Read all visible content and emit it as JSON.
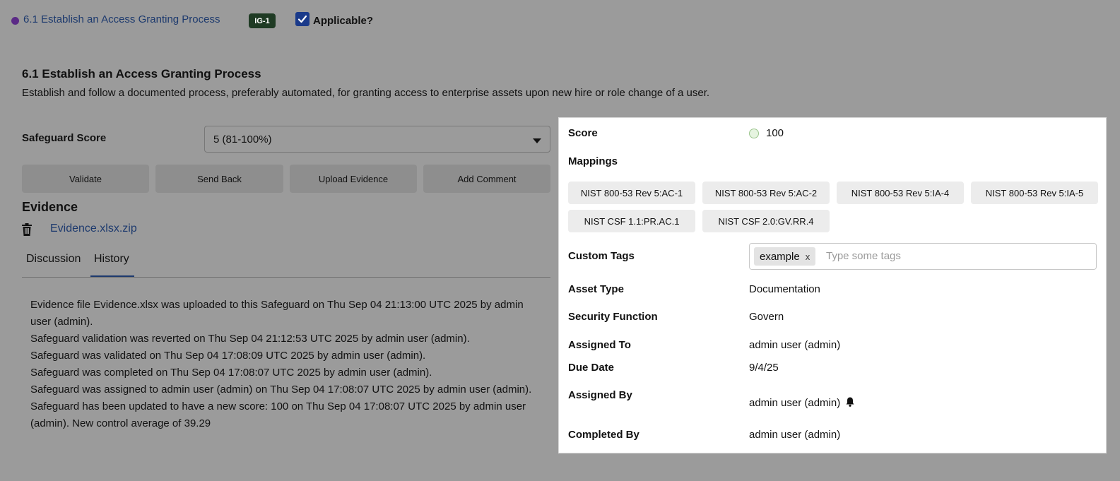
{
  "header": {
    "safeguard_link": "6.1 Establish an Access Granting Process",
    "ig_badge": "IG-1",
    "applicable_label": "Applicable?",
    "applicable_checked": true
  },
  "safeguard": {
    "title": "6.1 Establish an Access Granting Process",
    "description": "Establish and follow a documented process, preferably automated, for granting access to enterprise assets upon new hire or role change of a user."
  },
  "score_field": {
    "label": "Safeguard Score",
    "selected": "5 (81-100%)"
  },
  "actions": {
    "validate": "Validate",
    "send_back": "Send Back",
    "upload_evidence": "Upload Evidence",
    "add_comment": "Add Comment"
  },
  "evidence": {
    "title": "Evidence",
    "file": "Evidence.xlsx.zip"
  },
  "tabs": [
    {
      "label": "Discussion",
      "active": false
    },
    {
      "label": "History",
      "active": true
    }
  ],
  "history": [
    "Evidence file Evidence.xlsx was uploaded to this Safeguard on Thu Sep 04 21:13:00 UTC 2025 by admin user (admin).",
    "Safeguard validation was reverted on Thu Sep 04 21:12:53 UTC 2025 by admin user (admin).",
    "Safeguard was validated on Thu Sep 04 17:08:09 UTC 2025 by admin user (admin).",
    "Safeguard was completed on Thu Sep 04 17:08:07 UTC 2025 by admin user (admin).",
    "Safeguard was assigned to admin user (admin) on Thu Sep 04 17:08:07 UTC 2025 by admin user (admin).",
    "Safeguard has been updated to have a new score: 100 on Thu Sep 04 17:08:07 UTC 2025 by admin user (admin). New control average of 39.29"
  ],
  "panel": {
    "score_label": "Score",
    "score_value": "100",
    "mappings_label": "Mappings",
    "mappings": [
      "NIST 800-53 Rev 5:AC-1",
      "NIST 800-53 Rev 5:AC-2",
      "NIST 800-53 Rev 5:IA-4",
      "NIST 800-53 Rev 5:IA-5",
      "NIST CSF 1.1:PR.AC.1",
      "NIST CSF 2.0:GV.RR.4"
    ],
    "custom_tags_label": "Custom Tags",
    "tags": [
      "example"
    ],
    "tag_remove": "x",
    "tags_placeholder": "Type some tags",
    "asset_type_label": "Asset Type",
    "asset_type": "Documentation",
    "security_function_label": "Security Function",
    "security_function": "Govern",
    "assigned_to_label": "Assigned To",
    "assigned_to": "admin user (admin)",
    "due_date_label": "Due Date",
    "due_date": "9/4/25",
    "assigned_by_label": "Assigned By",
    "assigned_by": "admin user (admin)",
    "completed_by_label": "Completed By",
    "completed_by": "admin user (admin)"
  },
  "colors": {
    "page_bg": "#9b9b9b",
    "link": "#1d3a6e",
    "badge": "#1f3b24",
    "status_dot": "#5b2a86"
  }
}
